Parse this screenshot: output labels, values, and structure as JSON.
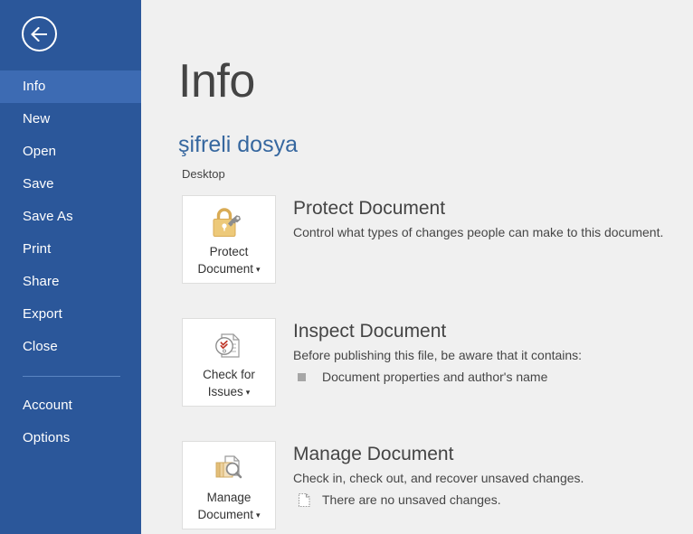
{
  "colors": {
    "sidebar_bg": "#2b579a",
    "sidebar_active": "#3d6bb3",
    "content_bg": "#f0f0f0",
    "accent_blue": "#36679f",
    "icon_gold": "#e8c778",
    "icon_gray": "#808080",
    "check_red": "#c0392b"
  },
  "sidebar": {
    "back_button": {
      "name": "back-arrow-icon",
      "label": "Back"
    },
    "items": [
      {
        "label": "Info",
        "active": true
      },
      {
        "label": "New",
        "active": false
      },
      {
        "label": "Open",
        "active": false
      },
      {
        "label": "Save",
        "active": false
      },
      {
        "label": "Save As",
        "active": false
      },
      {
        "label": "Print",
        "active": false
      },
      {
        "label": "Share",
        "active": false
      },
      {
        "label": "Export",
        "active": false
      },
      {
        "label": "Close",
        "active": false
      }
    ],
    "items_after_separator": [
      {
        "label": "Account",
        "active": false
      },
      {
        "label": "Options",
        "active": false
      }
    ]
  },
  "main": {
    "page_title": "Info",
    "document_name": "şifreli dosya",
    "document_path": "Desktop",
    "sections": {
      "protect": {
        "button_label_line1": "Protect",
        "button_label_line2": "Document",
        "button_icon": "padlock-key-icon",
        "heading": "Protect Document",
        "description": "Control what types of changes people can make to this document.",
        "bullets": []
      },
      "inspect": {
        "button_label_line1": "Check for",
        "button_label_line2": "Issues",
        "button_icon": "document-inspect-icon",
        "heading": "Inspect Document",
        "description": "Before publishing this file, be aware that it contains:",
        "bullets": [
          {
            "icon": "square-bullet-icon",
            "text": "Document properties and author's name"
          }
        ]
      },
      "manage": {
        "button_label_line1": "Manage",
        "button_label_line2": "Document",
        "button_icon": "document-stack-search-icon",
        "heading": "Manage Document",
        "description": "Check in, check out, and recover unsaved changes.",
        "bullets": [
          {
            "icon": "dashed-document-icon",
            "text": "There are no unsaved changes."
          }
        ]
      }
    }
  }
}
